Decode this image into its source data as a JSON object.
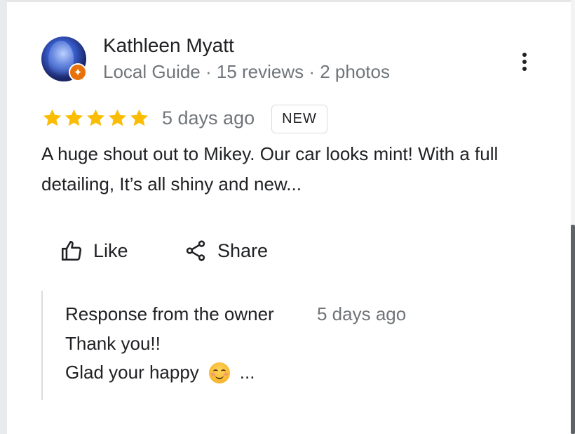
{
  "reviewer": {
    "name": "Kathleen Myatt",
    "meta": "Local Guide · 15 reviews · 2 photos",
    "avatar_icon": "profile-photo",
    "badge_icon": "local-guide-star-badge"
  },
  "review": {
    "rating": 5,
    "max_rating": 5,
    "date": "5 days ago",
    "badge": "NEW",
    "text": "A huge shout out to Mikey. Our car looks mint! With a full detailing, It’s all shiny and new..."
  },
  "actions": {
    "like_label": "Like",
    "share_label": "Share",
    "more_icon": "more-vert-icon"
  },
  "owner_response": {
    "title": "Response from the owner",
    "date": "5 days ago",
    "line1": "Thank you!!",
    "line2": "Glad your happy",
    "emoji": "smiling-face",
    "more": "..."
  },
  "colors": {
    "star": "#fbbc04",
    "text_primary": "#202124",
    "text_secondary": "#70757a",
    "local_guide_badge": "#e8710a",
    "divider": "#dadce0"
  }
}
